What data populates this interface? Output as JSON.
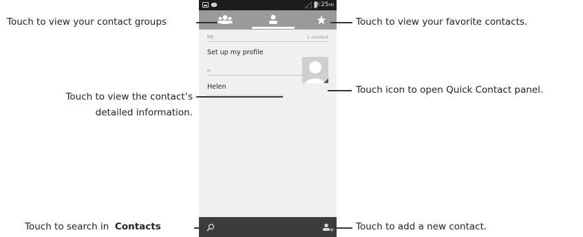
{
  "statusbar": {
    "time": "9:25",
    "ampm": "PM"
  },
  "tabs": [
    {
      "icon": "groups-icon"
    },
    {
      "icon": "person-icon"
    },
    {
      "icon": "star-icon"
    }
  ],
  "contacts": {
    "me_header": "ME",
    "me_count": "1 contact",
    "profile_row": "Set up my profile",
    "h_header": "H",
    "contact_name": "Helen"
  },
  "callouts": {
    "groups": "Touch to view your contact groups",
    "favorites": "Touch to view your favorite contacts.",
    "details_line1": "Touch to view the contact’s",
    "details_line2": "detailed information.",
    "quick_contact": "Touch icon to open Quick Contact panel.",
    "search_prefix": "Touch to search in",
    "search_bold": "Contacts",
    "add_contact": "Touch to add a new contact."
  }
}
